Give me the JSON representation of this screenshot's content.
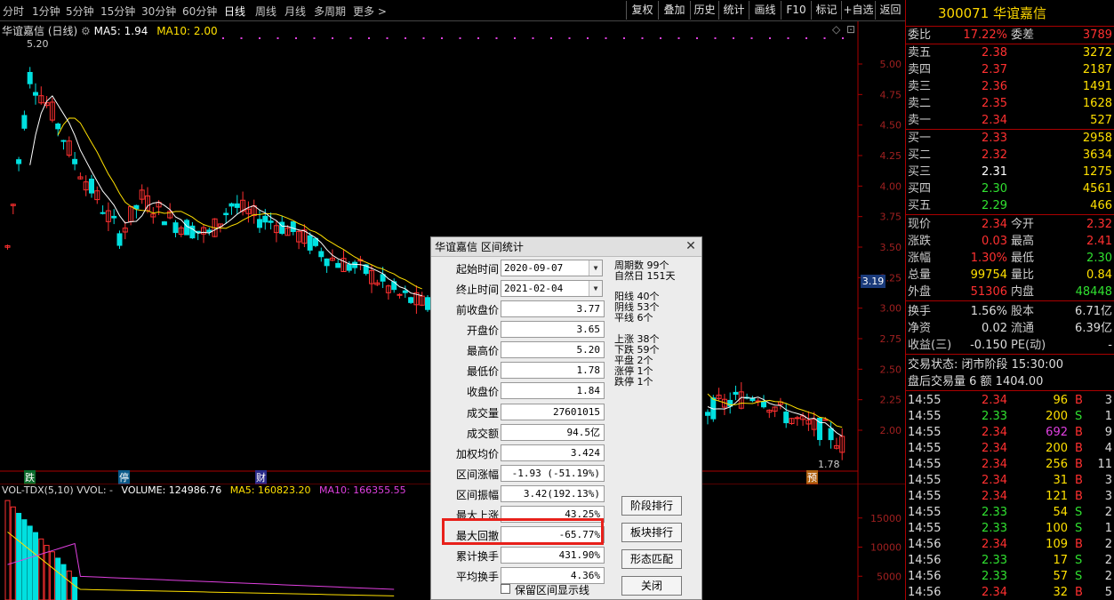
{
  "periods": [
    "分时",
    "1分钟",
    "5分钟",
    "15分钟",
    "30分钟",
    "60分钟",
    "日线",
    "周线",
    "月线",
    "多周期",
    "更多 >"
  ],
  "active_period": "日线",
  "tools": [
    "复权",
    "叠加",
    "历史",
    "统计",
    "画线",
    "F10",
    "标记",
    "+自选",
    "返回"
  ],
  "chart": {
    "stock_label": "华谊嘉信 (日线)",
    "ma5": "MA5: 1.94",
    "ma10": "MA10: 2.00",
    "price_ticks": [
      "5.00",
      "4.75",
      "4.50",
      "4.25",
      "4.00",
      "3.75",
      "3.50",
      "3.25",
      "3.00",
      "2.75",
      "2.50",
      "2.25",
      "2.00"
    ],
    "current_price_tag": "3.19",
    "high_label": "5.20",
    "low_label": "1.78",
    "markers": [
      "跌",
      "停",
      "财",
      "预"
    ]
  },
  "volume": {
    "indicator": "VOL-TDX(5,10)",
    "vvol": "VVOL: -",
    "volume": "VOLUME: 124986.76",
    "ma5": "MA5: 160823.20",
    "ma10": "MA10: 166355.55",
    "ticks": [
      "15000",
      "10000",
      "5000"
    ]
  },
  "quote": {
    "code_name": "300071 华谊嘉信",
    "wei_bi_label": "委比",
    "wei_bi": "17.22%",
    "wei_cha_label": "委差",
    "wei_cha": "3789",
    "sell": [
      {
        "label": "卖五",
        "price": "2.38",
        "vol": "3272"
      },
      {
        "label": "卖四",
        "price": "2.37",
        "vol": "2187"
      },
      {
        "label": "卖三",
        "price": "2.36",
        "vol": "1491"
      },
      {
        "label": "卖二",
        "price": "2.35",
        "vol": "1628"
      },
      {
        "label": "卖一",
        "price": "2.34",
        "vol": "527"
      }
    ],
    "buy": [
      {
        "label": "买一",
        "price": "2.33",
        "vol": "2958"
      },
      {
        "label": "买二",
        "price": "2.32",
        "vol": "3634"
      },
      {
        "label": "买三",
        "price": "2.31",
        "vol": "1275"
      },
      {
        "label": "买四",
        "price": "2.30",
        "vol": "4561"
      },
      {
        "label": "买五",
        "price": "2.29",
        "vol": "466"
      }
    ],
    "stats": [
      {
        "l1": "现价",
        "v1": "2.34",
        "l2": "今开",
        "v2": "2.32"
      },
      {
        "l1": "涨跌",
        "v1": "0.03",
        "l2": "最高",
        "v2": "2.41"
      },
      {
        "l1": "涨幅",
        "v1": "1.30%",
        "l2": "最低",
        "v2": "2.30"
      },
      {
        "l1": "总量",
        "v1": "99754",
        "l2": "量比",
        "v2": "0.84"
      },
      {
        "l1": "外盘",
        "v1": "51306",
        "l2": "内盘",
        "v2": "48448"
      }
    ],
    "stats2": [
      {
        "l1": "换手",
        "v1": "1.56%",
        "l2": "股本",
        "v2": "6.71亿"
      },
      {
        "l1": "净资",
        "v1": "0.02",
        "l2": "流通",
        "v2": "6.39亿"
      },
      {
        "l1": "收益(三)",
        "v1": "-0.150",
        "l2": "PE(动)",
        "v2": "-"
      }
    ],
    "trade_status": "交易状态: 闭市阶段 15:30:00",
    "after_hours": "盘后交易量 6 额 1404.00",
    "ticks": [
      {
        "t": "14:55",
        "p": "2.34",
        "v": "96",
        "s": "B",
        "n": "3"
      },
      {
        "t": "14:55",
        "p": "2.33",
        "v": "200",
        "s": "S",
        "n": "1"
      },
      {
        "t": "14:55",
        "p": "2.34",
        "v": "692",
        "s": "B",
        "n": "9"
      },
      {
        "t": "14:55",
        "p": "2.34",
        "v": "200",
        "s": "B",
        "n": "4"
      },
      {
        "t": "14:55",
        "p": "2.34",
        "v": "256",
        "s": "B",
        "n": "11"
      },
      {
        "t": "14:55",
        "p": "2.34",
        "v": "31",
        "s": "B",
        "n": "3"
      },
      {
        "t": "14:55",
        "p": "2.34",
        "v": "121",
        "s": "B",
        "n": "3"
      },
      {
        "t": "14:55",
        "p": "2.33",
        "v": "54",
        "s": "S",
        "n": "2"
      },
      {
        "t": "14:55",
        "p": "2.33",
        "v": "100",
        "s": "S",
        "n": "1"
      },
      {
        "t": "14:56",
        "p": "2.34",
        "v": "109",
        "s": "B",
        "n": "2"
      },
      {
        "t": "14:56",
        "p": "2.33",
        "v": "17",
        "s": "S",
        "n": "2"
      },
      {
        "t": "14:56",
        "p": "2.33",
        "v": "57",
        "s": "S",
        "n": "2"
      },
      {
        "t": "14:56",
        "p": "2.34",
        "v": "32",
        "s": "B",
        "n": "5"
      }
    ]
  },
  "dialog": {
    "title": "华谊嘉信 区间统计",
    "start_label": "起始时间",
    "start": "2020-09-07",
    "end_label": "终止时间",
    "end": "2021-02-04",
    "fields": [
      {
        "label": "前收盘价",
        "value": "3.77"
      },
      {
        "label": "开盘价",
        "value": "3.65"
      },
      {
        "label": "最高价",
        "value": "5.20"
      },
      {
        "label": "最低价",
        "value": "1.78"
      },
      {
        "label": "收盘价",
        "value": "1.84"
      },
      {
        "label": "成交量",
        "value": "27601015"
      },
      {
        "label": "成交额",
        "value": "94.5亿"
      },
      {
        "label": "加权均价",
        "value": "3.424"
      },
      {
        "label": "区间涨幅",
        "value": "-1.93 (-51.19%)"
      },
      {
        "label": "区间振幅",
        "value": "3.42(192.13%)"
      },
      {
        "label": "最大上涨",
        "value": "43.25%"
      },
      {
        "label": "最大回撤",
        "value": "-65.77%"
      },
      {
        "label": "累计换手",
        "value": "431.90%"
      },
      {
        "label": "平均换手",
        "value": "4.36%"
      }
    ],
    "stats": [
      "周期数 99个",
      "自然日 151天",
      "阳线 40个",
      "阴线 53个",
      "平线 6个",
      "上涨 38个",
      "下跌 59个",
      "平盘 2个",
      "涨停 1个",
      "跌停 1个"
    ],
    "buttons": [
      "阶段排行",
      "板块排行",
      "形态匹配",
      "关闭"
    ],
    "keep_line_label": "保留区间显示线"
  },
  "colors": {
    "up": "#ff3030",
    "down": "#00e0e0",
    "ma5": "#ffffff",
    "ma10": "#ffe000",
    "accent": "#e8201a"
  }
}
